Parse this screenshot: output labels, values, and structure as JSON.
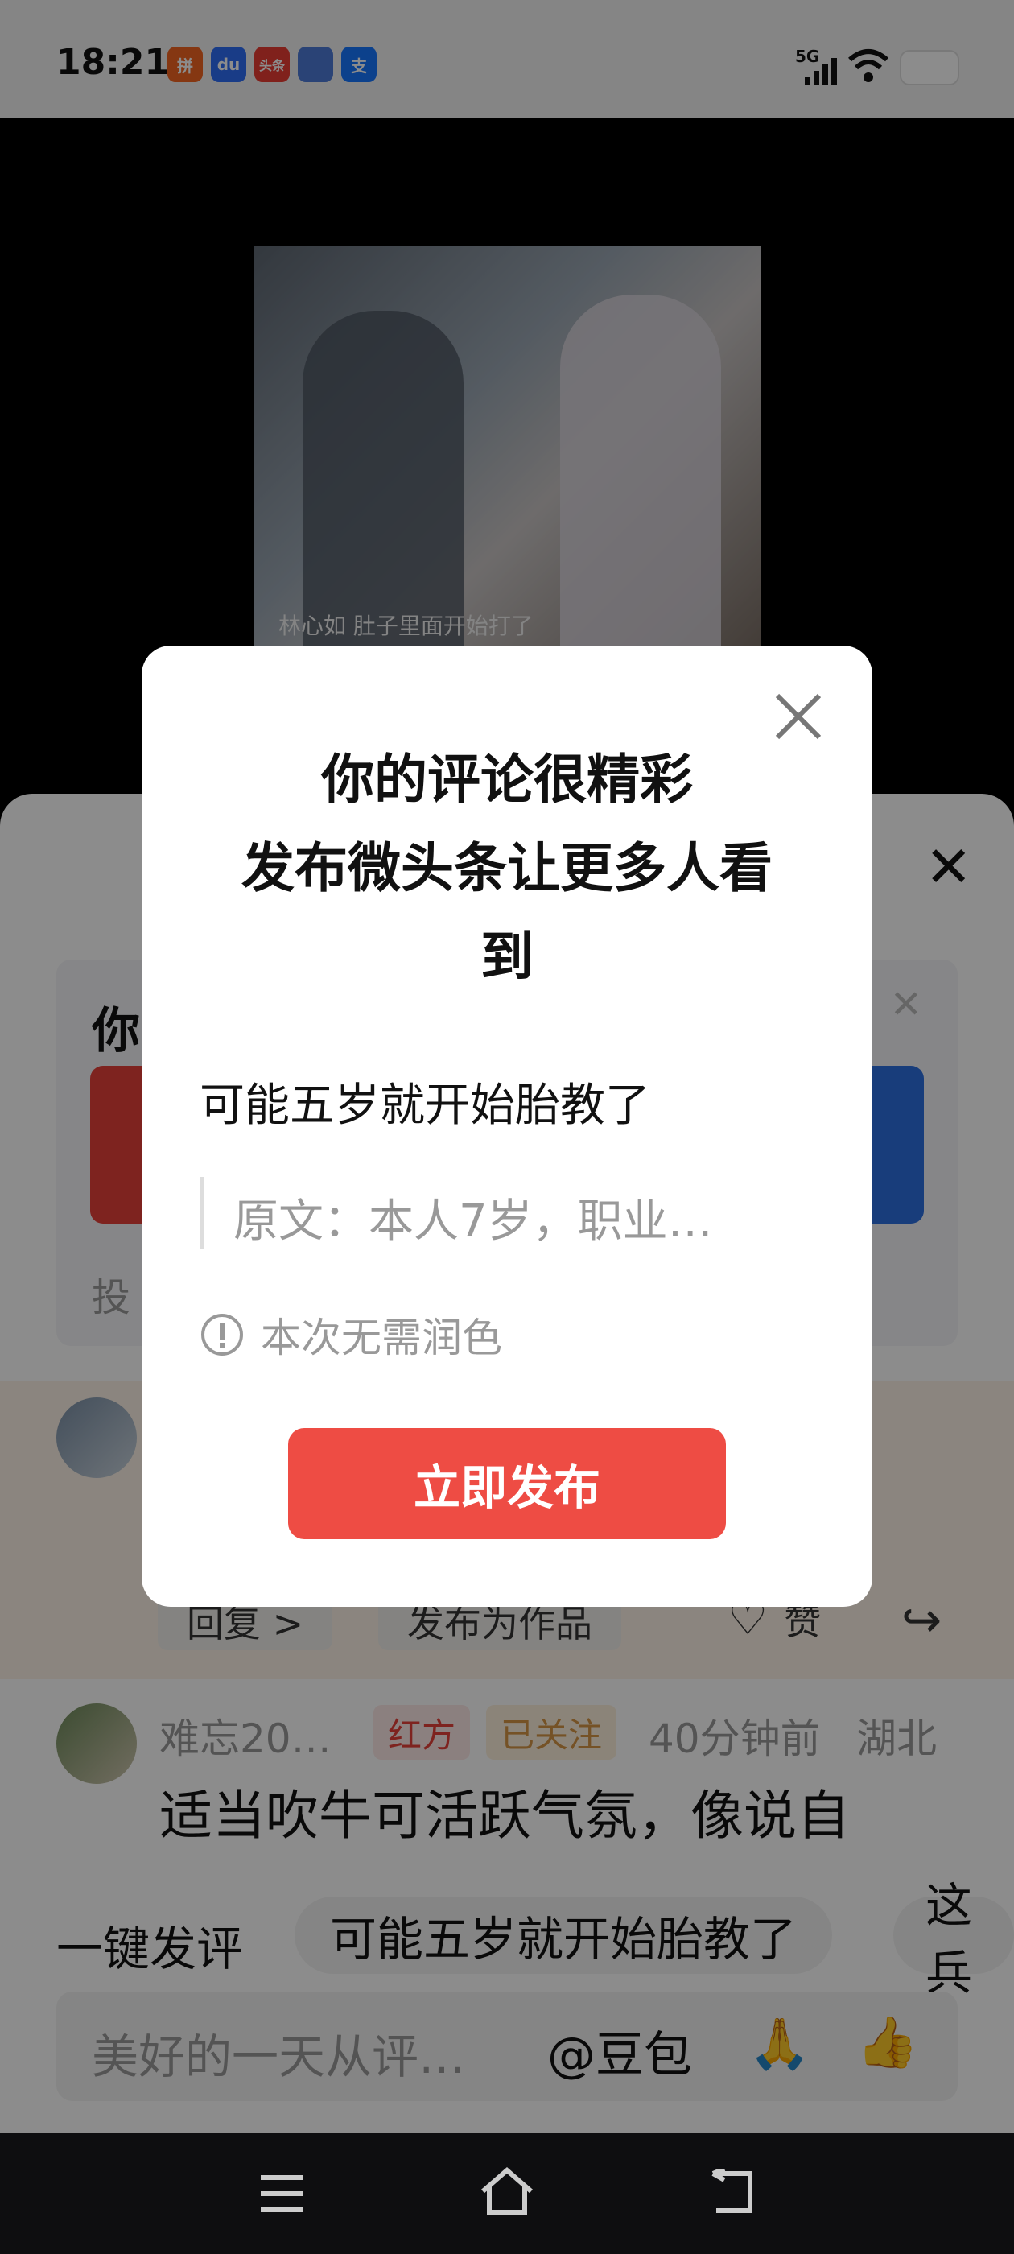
{
  "status_bar": {
    "time": "18:21",
    "network": "5G",
    "app_icons": [
      {
        "name": "pinduoduo-icon",
        "label": "拼",
        "color": "#f26522"
      },
      {
        "name": "baidu-icon",
        "label": "du",
        "color": "#2f6df6"
      },
      {
        "name": "toutiao-icon",
        "label": "头条",
        "color": "#e93c33"
      },
      {
        "name": "game-icon",
        "label": "",
        "color": "#4e7bd8"
      },
      {
        "name": "alipay-icon",
        "label": "支",
        "color": "#1677ff"
      }
    ]
  },
  "video": {
    "caption": "林心如 肚子里面开始打了"
  },
  "sheet": {
    "vote_title": "你",
    "vote_footer": "投",
    "reply_label": "回复 >",
    "publish_work_label": "发布为作品",
    "like_label": "赞",
    "comment2": {
      "username": "难忘20…",
      "team_tag": "红方",
      "follow_tag": "已关注",
      "time": "40分钟前",
      "location": "湖北",
      "text": "适当吹牛可活跃气氛，像说自"
    }
  },
  "quick_reply": {
    "label": "一键发评",
    "suggestions": [
      "可能五岁就开始胎教了",
      "这兵"
    ]
  },
  "input": {
    "placeholder": "美好的一天从评…",
    "mention": "@豆包",
    "emoji1": "🙏",
    "emoji2": "👍"
  },
  "dialog": {
    "title_line1": "你的评论很精彩",
    "title_line2": "发布微头条让更多人看",
    "title_line3": "到",
    "polished_text": "可能五岁就开始胎教了",
    "original_text": "原文：本人7岁，职业…",
    "tip": "本次无需润色",
    "publish_button": "立即发布"
  },
  "colors": {
    "accent_red": "#ee4c44",
    "blue": "#2d6fe0"
  }
}
